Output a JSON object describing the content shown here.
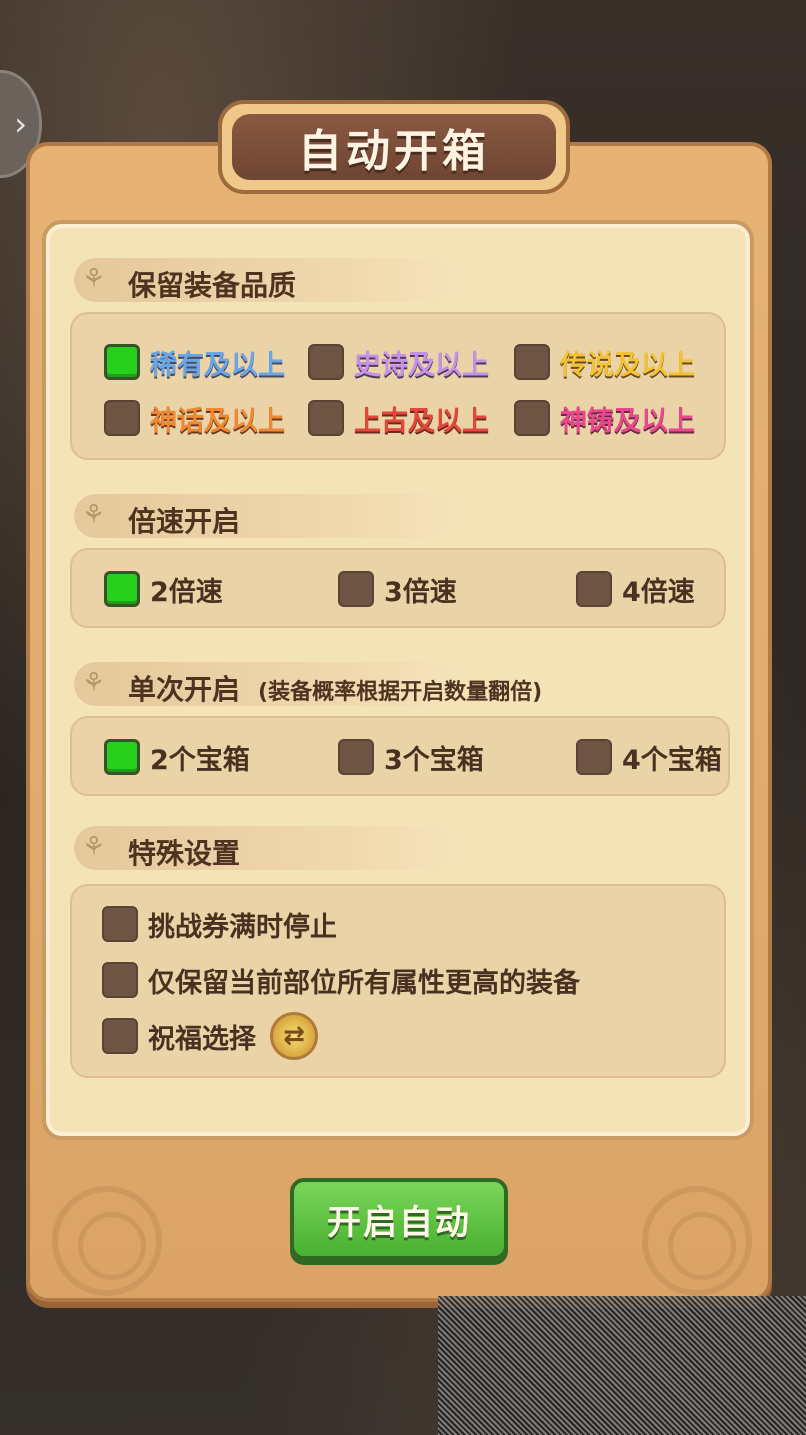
{
  "title": "自动开箱",
  "sections": {
    "quality": {
      "heading": "保留装备品质",
      "options": [
        {
          "label": "稀有及以上",
          "checked": true
        },
        {
          "label": "史诗及以上",
          "checked": false
        },
        {
          "label": "传说及以上",
          "checked": false
        },
        {
          "label": "神话及以上",
          "checked": false
        },
        {
          "label": "上古及以上",
          "checked": false
        },
        {
          "label": "神铸及以上",
          "checked": false
        }
      ]
    },
    "speed": {
      "heading": "倍速开启",
      "options": [
        {
          "label": "2倍速",
          "checked": true
        },
        {
          "label": "3倍速",
          "checked": false
        },
        {
          "label": "4倍速",
          "checked": false
        }
      ]
    },
    "single": {
      "heading": "单次开启",
      "note": "(装备概率根据开启数量翻倍)",
      "options": [
        {
          "label": "2个宝箱",
          "checked": true
        },
        {
          "label": "3个宝箱",
          "checked": false
        },
        {
          "label": "4个宝箱",
          "checked": false
        }
      ]
    },
    "special": {
      "heading": "特殊设置",
      "options": [
        {
          "label": "挑战券满时停止",
          "checked": false
        },
        {
          "label": "仅保留当前部位所有属性更高的装备",
          "checked": false
        },
        {
          "label": "祝福选择",
          "checked": false
        }
      ]
    }
  },
  "start_button": "开启自动",
  "icons": {
    "side_tab": "chevron-right-icon",
    "section_leaf": "leaf-icon",
    "swap": "swap-icon"
  },
  "colors": {
    "checked": "#27d01c",
    "unchecked": "#6e5443",
    "q_rare": "#6aa6e6",
    "q_epic": "#c790e8",
    "q_legend": "#f3c233",
    "q_myth": "#f08833",
    "q_ancient": "#e4463a",
    "q_forged": "#e8488c"
  }
}
